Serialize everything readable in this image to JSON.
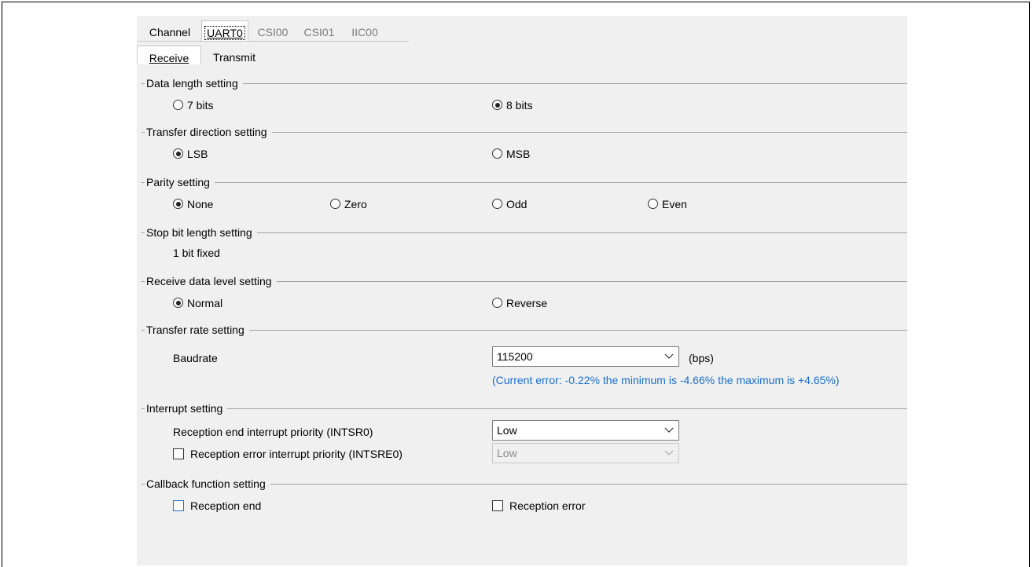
{
  "top_tabs": [
    {
      "label": "Channel",
      "state": "normal"
    },
    {
      "label": "UART0",
      "state": "active"
    },
    {
      "label": "CSI00",
      "state": "inactive"
    },
    {
      "label": "CSI01",
      "state": "inactive"
    },
    {
      "label": "IIC00",
      "state": "inactive"
    }
  ],
  "sub_tabs": [
    {
      "label": "Receive",
      "state": "active"
    },
    {
      "label": "Transmit",
      "state": "normal"
    }
  ],
  "data_length": {
    "title": "Data length setting",
    "options": [
      "7 bits",
      "8 bits"
    ],
    "selected": "8 bits"
  },
  "transfer_direction": {
    "title": "Transfer direction setting",
    "options": [
      "LSB",
      "MSB"
    ],
    "selected": "LSB"
  },
  "parity": {
    "title": "Parity setting",
    "options": [
      "None",
      "Zero",
      "Odd",
      "Even"
    ],
    "selected": "None"
  },
  "stop_bit": {
    "title": "Stop bit length setting",
    "value": "1 bit fixed"
  },
  "receive_level": {
    "title": "Receive data level setting",
    "options": [
      "Normal",
      "Reverse"
    ],
    "selected": "Normal"
  },
  "transfer_rate": {
    "title": "Transfer rate setting",
    "label": "Baudrate",
    "value": "115200",
    "unit": "(bps)",
    "error_note": "(Current error: -0.22% the minimum is -4.66% the maximum is +4.65%)"
  },
  "interrupt": {
    "title": "Interrupt setting",
    "end_label": "Reception end interrupt priority (INTSR0)",
    "end_value": "Low",
    "error_label": "Reception error interrupt priority (INTSRE0)",
    "error_value": "Low",
    "error_checked": false
  },
  "callback": {
    "title": "Callback function setting",
    "end_label": "Reception end",
    "error_label": "Reception error",
    "end_checked": false,
    "error_checked": false
  },
  "colors": {
    "panel": "#f0f0f0",
    "note": "#1a6fd1",
    "focus": "#1f6fd0"
  }
}
